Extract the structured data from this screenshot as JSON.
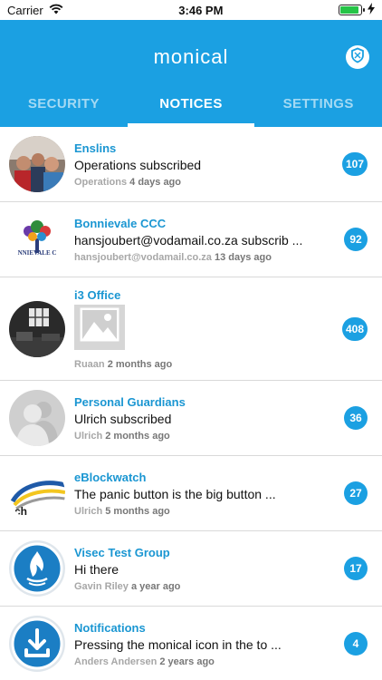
{
  "status": {
    "carrier": "Carrier",
    "time": "3:46 PM"
  },
  "header": {
    "title": "monical"
  },
  "tabs": [
    {
      "label": "SECURITY",
      "active": false
    },
    {
      "label": "NOTICES",
      "active": true
    },
    {
      "label": "SETTINGS",
      "active": false
    }
  ],
  "notices": [
    {
      "name": "Enslins",
      "message": "Operations subscribed",
      "author": "Operations",
      "time": "4 days ago",
      "count": "107",
      "icon": "group-photo-avatar"
    },
    {
      "name": "Bonnievale CCC",
      "message": "hansjoubert@vodamail.co.za subscrib ...",
      "author": "hansjoubert@vodamail.co.za",
      "time": "13 days ago",
      "count": "92",
      "icon": "tree-logo-avatar",
      "logo_text": "NNIEVALE C"
    },
    {
      "name": "i3 Office",
      "message": "",
      "author": "Ruaan",
      "time": "2 months ago",
      "count": "408",
      "icon": "office-photo-avatar",
      "has_image": true
    },
    {
      "name": "Personal Guardians",
      "message": "Ulrich subscribed",
      "author": "Ulrich",
      "time": "2 months ago",
      "count": "36",
      "icon": "people-placeholder-avatar"
    },
    {
      "name": "eBlockwatch",
      "message": "The panic button is the big button ...",
      "author": "Ulrich",
      "time": "5 months ago",
      "count": "27",
      "icon": "eblockwatch-logo-avatar",
      "logo_text": "ch"
    },
    {
      "name": "Visec Test Group",
      "message": "Hi there",
      "author": "Gavin Riley",
      "time": "a year ago",
      "count": "17",
      "icon": "flame-logo-avatar"
    },
    {
      "name": "Notifications",
      "message": "Pressing the monical icon in the to ...",
      "author": "Anders Andersen",
      "time": "2 years ago",
      "count": "4",
      "icon": "download-logo-avatar"
    }
  ],
  "colors": {
    "brand": "#1ba0e2",
    "name": "#1a96d2"
  }
}
